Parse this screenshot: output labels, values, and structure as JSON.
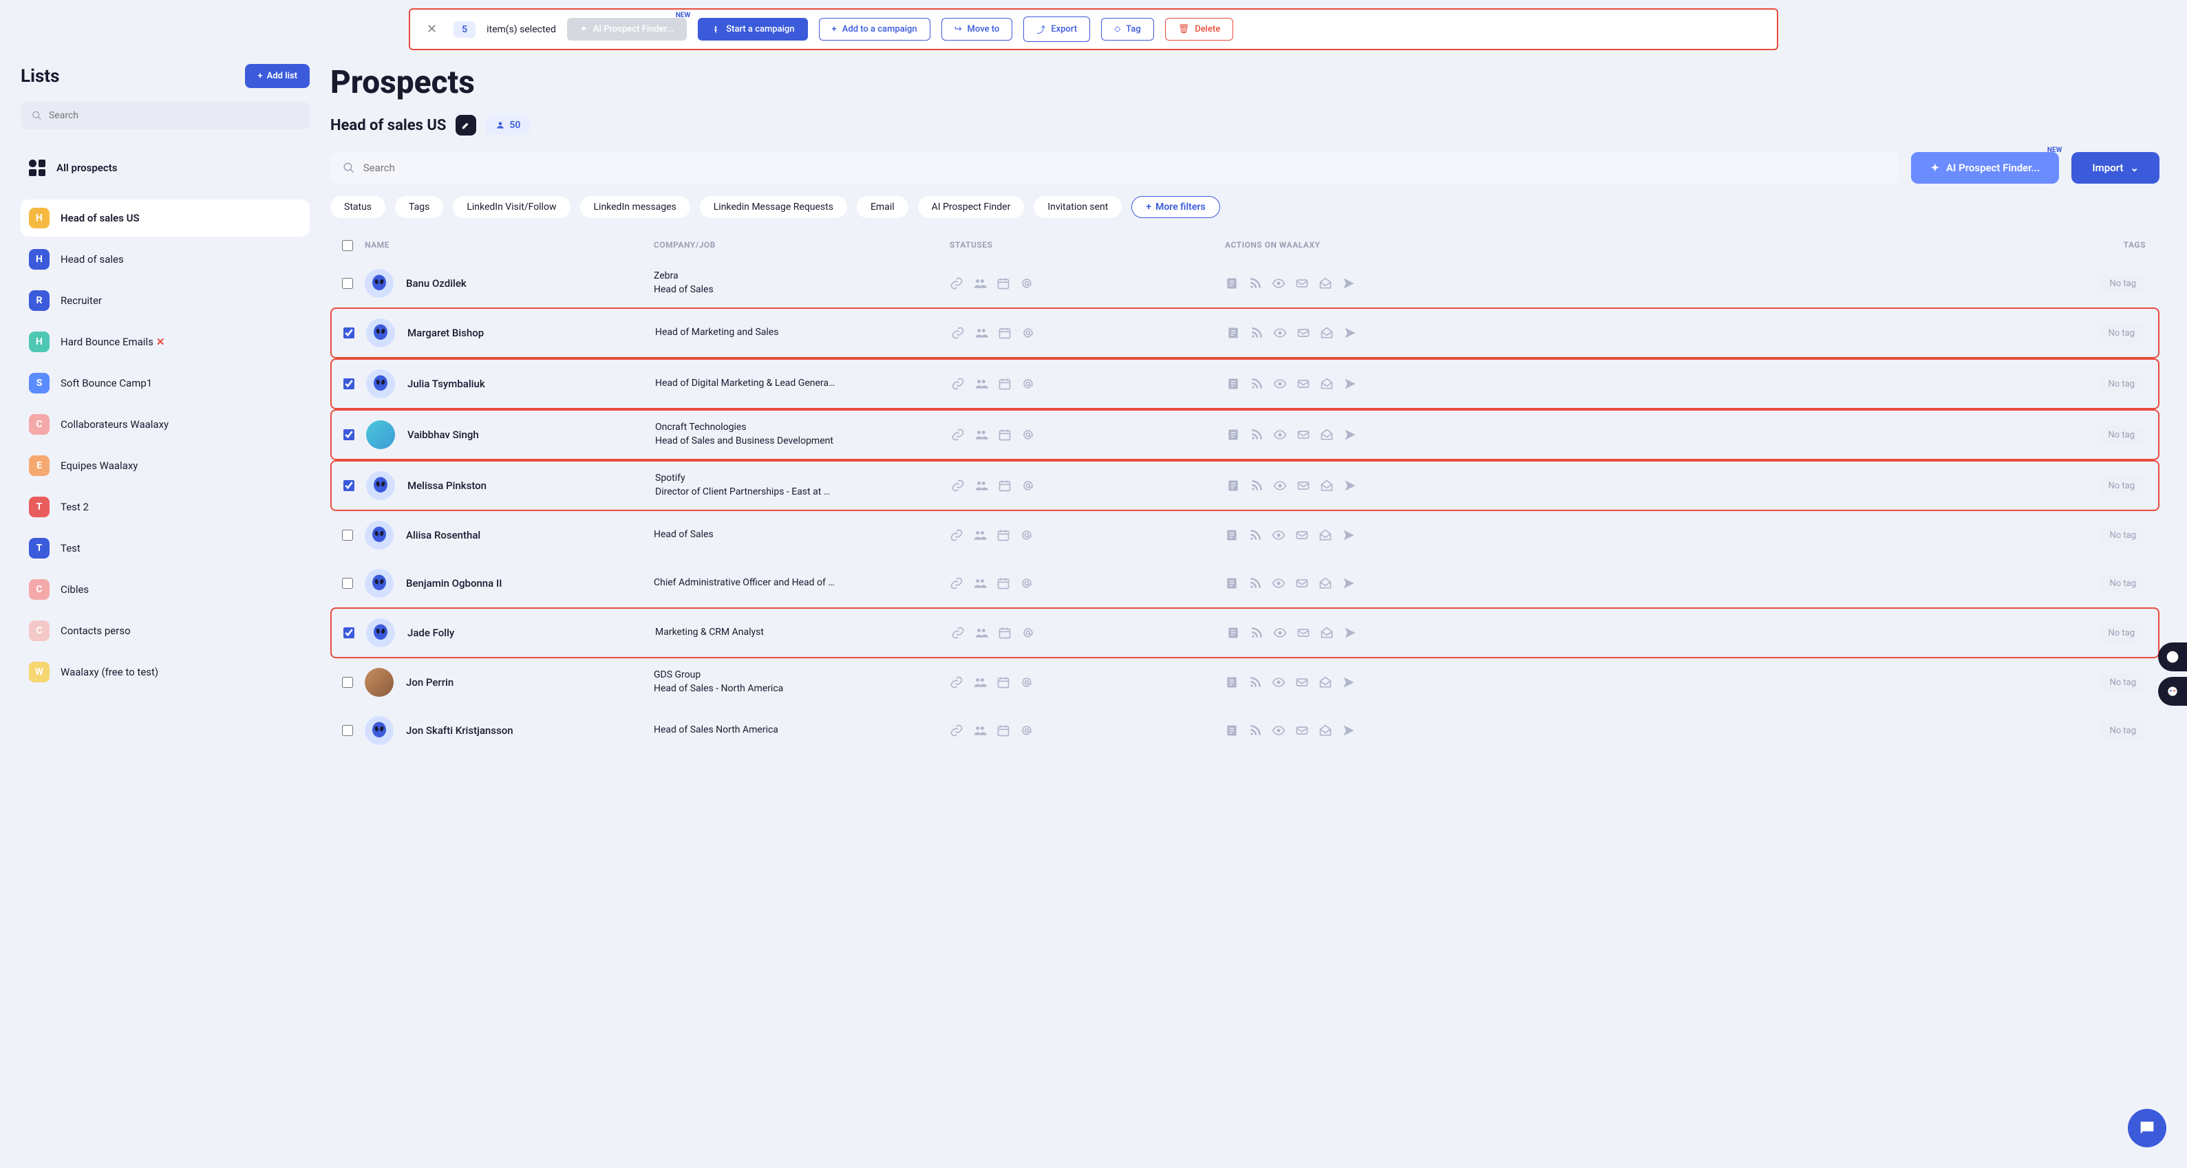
{
  "toolbar": {
    "count": "5",
    "count_text": "item(s) selected",
    "ai_finder": "AI Prospect Finder...",
    "new_badge": "NEW",
    "start_campaign": "Start a campaign",
    "add_to_campaign": "Add to a campaign",
    "move_to": "Move to",
    "export": "Export",
    "tag": "Tag",
    "delete": "Delete"
  },
  "sidebar": {
    "title": "Lists",
    "add_list": "Add list",
    "search_placeholder": "Search",
    "all_prospects": "All prospects",
    "items": [
      {
        "letter": "H",
        "color": "#f5b942",
        "label": "Head of sales US",
        "active": true
      },
      {
        "letter": "H",
        "color": "#3b5bdb",
        "label": "Head of sales"
      },
      {
        "letter": "R",
        "color": "#3b5bdb",
        "label": "Recruiter"
      },
      {
        "letter": "H",
        "color": "#4ec8b4",
        "label": "Hard Bounce Emails",
        "cross": true
      },
      {
        "letter": "S",
        "color": "#5b8cff",
        "label": "Soft Bounce Camp1"
      },
      {
        "letter": "C",
        "color": "#f5a8a8",
        "label": "Collaborateurs Waalaxy"
      },
      {
        "letter": "E",
        "color": "#f5a870",
        "label": "Equipes Waalaxy"
      },
      {
        "letter": "T",
        "color": "#e85c5c",
        "label": "Test 2"
      },
      {
        "letter": "T",
        "color": "#3b5bdb",
        "label": "Test"
      },
      {
        "letter": "C",
        "color": "#f5a8a8",
        "label": "Cibles"
      },
      {
        "letter": "C",
        "color": "#f5c8c8",
        "label": "Contacts perso"
      },
      {
        "letter": "W",
        "color": "#f5d670",
        "label": "Waalaxy (free to test)"
      }
    ]
  },
  "main": {
    "page_title": "Prospects",
    "list_name": "Head of sales US",
    "count": "50",
    "search_placeholder": "Search",
    "ai_finder": "AI Prospect Finder...",
    "new_badge": "NEW",
    "import": "Import",
    "filters": [
      "Status",
      "Tags",
      "LinkedIn Visit/Follow",
      "LinkedIn messages",
      "Linkedin Message Requests",
      "Email",
      "AI Prospect Finder",
      "Invitation sent"
    ],
    "more_filters": "More filters",
    "columns": {
      "name": "NAME",
      "company": "COMPANY/JOB",
      "statuses": "STATUSES",
      "actions": "ACTIONS ON WAALAXY",
      "tags": "TAGS"
    },
    "no_tag": "No tag",
    "rows": [
      {
        "checked": false,
        "name": "Banu Ozdilek",
        "company": "Zebra",
        "job": "Head of Sales",
        "avatar": "alien"
      },
      {
        "checked": true,
        "highlight": true,
        "name": "Margaret Bishop",
        "company": "",
        "job": "Head of Marketing and Sales",
        "avatar": "alien"
      },
      {
        "checked": true,
        "highlight": true,
        "name": "Julia Tsymbaliuk",
        "company": "",
        "job": "Head of Digital Marketing & Lead Genera…",
        "avatar": "alien"
      },
      {
        "checked": true,
        "highlight": true,
        "name": "Vaibbhav Singh",
        "company": "Oncraft Technologies",
        "job": "Head of Sales and Business Development",
        "avatar": "photo1"
      },
      {
        "checked": true,
        "highlight": true,
        "name": "Melissa Pinkston",
        "company": "Spotify",
        "job": "Director of Client Partnerships - East at …",
        "avatar": "alien"
      },
      {
        "checked": false,
        "name": "Aliisa Rosenthal",
        "company": "",
        "job": "Head of Sales",
        "avatar": "alien"
      },
      {
        "checked": false,
        "name": "Benjamin Ogbonna II",
        "company": "",
        "job": "Chief Administrative Officer and Head of …",
        "avatar": "alien"
      },
      {
        "checked": true,
        "highlight": true,
        "name": "Jade Folly",
        "company": "",
        "job": "Marketing & CRM Analyst",
        "avatar": "alien"
      },
      {
        "checked": false,
        "name": "Jon Perrin",
        "company": "GDS Group",
        "job": "Head of Sales - North America",
        "avatar": "photo2"
      },
      {
        "checked": false,
        "name": "Jon Skafti Kristjansson",
        "company": "",
        "job": "Head of Sales North America",
        "avatar": "alien"
      }
    ]
  }
}
